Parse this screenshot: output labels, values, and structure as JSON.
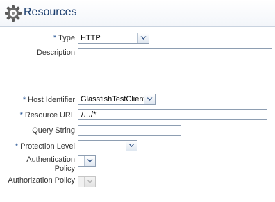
{
  "header": {
    "title": "Resources",
    "icon": "gear-icon"
  },
  "form": {
    "required_marker": "*",
    "type": {
      "label": "Type",
      "required": true,
      "value": "HTTP"
    },
    "description": {
      "label": "Description",
      "value": ""
    },
    "host_identifier": {
      "label": "Host Identifier",
      "required": true,
      "value": "GlassfishTestClient"
    },
    "resource_url": {
      "label": "Resource URL",
      "required": true,
      "value": "/…/*"
    },
    "query_string": {
      "label": "Query String",
      "value": ""
    },
    "protection_level": {
      "label": "Protection Level",
      "required": true,
      "value": ""
    },
    "authentication_policy": {
      "label": "Authentication Policy",
      "value": ""
    },
    "authorization_policy": {
      "label": "Authorization Policy",
      "value": "",
      "disabled": true
    }
  },
  "colors": {
    "header_text": "#1a3d6e",
    "required_marker": "#1f4f91",
    "field_border": "#8e9eb2",
    "chevron": "#2a4c80"
  }
}
